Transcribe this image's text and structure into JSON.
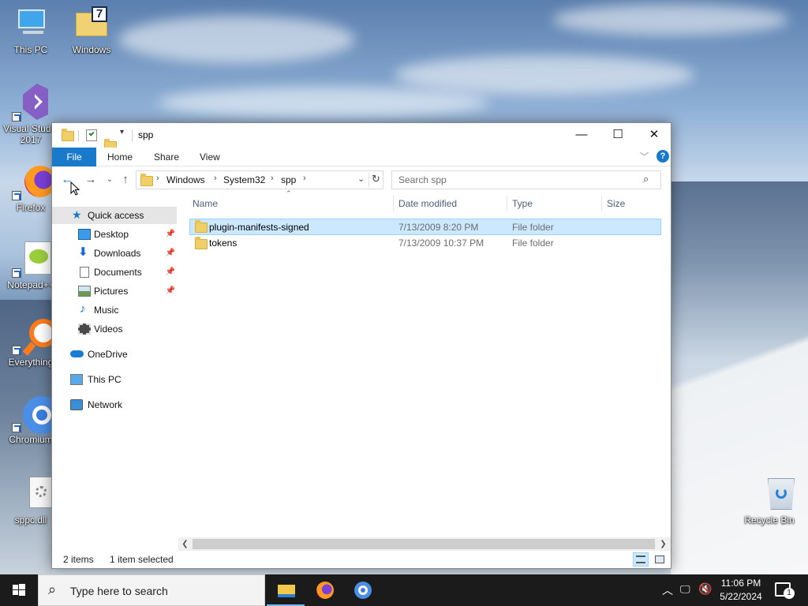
{
  "desktop": {
    "icons": [
      {
        "label": "This PC",
        "icon": "this-pc-icon"
      },
      {
        "label": "Windows",
        "icon": "folder-icon"
      },
      {
        "label": "Visual Studio 2017",
        "icon": "visual-studio-icon"
      },
      {
        "label": "Firefox",
        "icon": "firefox-icon"
      },
      {
        "label": "Notepad++",
        "icon": "notepad-plus-plus-icon"
      },
      {
        "label": "Everything",
        "icon": "everything-icon"
      },
      {
        "label": "Chromium",
        "icon": "chromium-icon"
      },
      {
        "label": "sppc.dll",
        "icon": "dll-file-icon"
      },
      {
        "label": "Recycle Bin",
        "icon": "recycle-bin-icon"
      }
    ]
  },
  "window": {
    "title": "spp",
    "ribbon_tabs": [
      "File",
      "Home",
      "Share",
      "View"
    ],
    "breadcrumbs": [
      "Windows",
      "System32",
      "spp"
    ],
    "search_placeholder": "Search spp",
    "nav": {
      "quick_access": "Quick access",
      "quick_items": [
        "Desktop",
        "Downloads",
        "Documents",
        "Pictures",
        "Music",
        "Videos"
      ],
      "onedrive": "OneDrive",
      "this_pc": "This PC",
      "network": "Network"
    },
    "columns": [
      "Name",
      "Date modified",
      "Type",
      "Size"
    ],
    "files": [
      {
        "name": "plugin-manifests-signed",
        "date": "7/13/2009 8:20 PM",
        "type": "File folder",
        "size": "",
        "selected": true
      },
      {
        "name": "tokens",
        "date": "7/13/2009 10:37 PM",
        "type": "File folder",
        "size": "",
        "selected": false
      }
    ],
    "status": {
      "count": "2 items",
      "selection": "1 item selected"
    }
  },
  "taskbar": {
    "search_placeholder": "Type here to search",
    "time": "11:06 PM",
    "date": "5/22/2024",
    "notification_count": "1"
  },
  "colors": {
    "accent": "#1979ca",
    "selection": "#cce8ff",
    "taskbar": "#1b1b1b",
    "folder": "#f0cf68"
  }
}
